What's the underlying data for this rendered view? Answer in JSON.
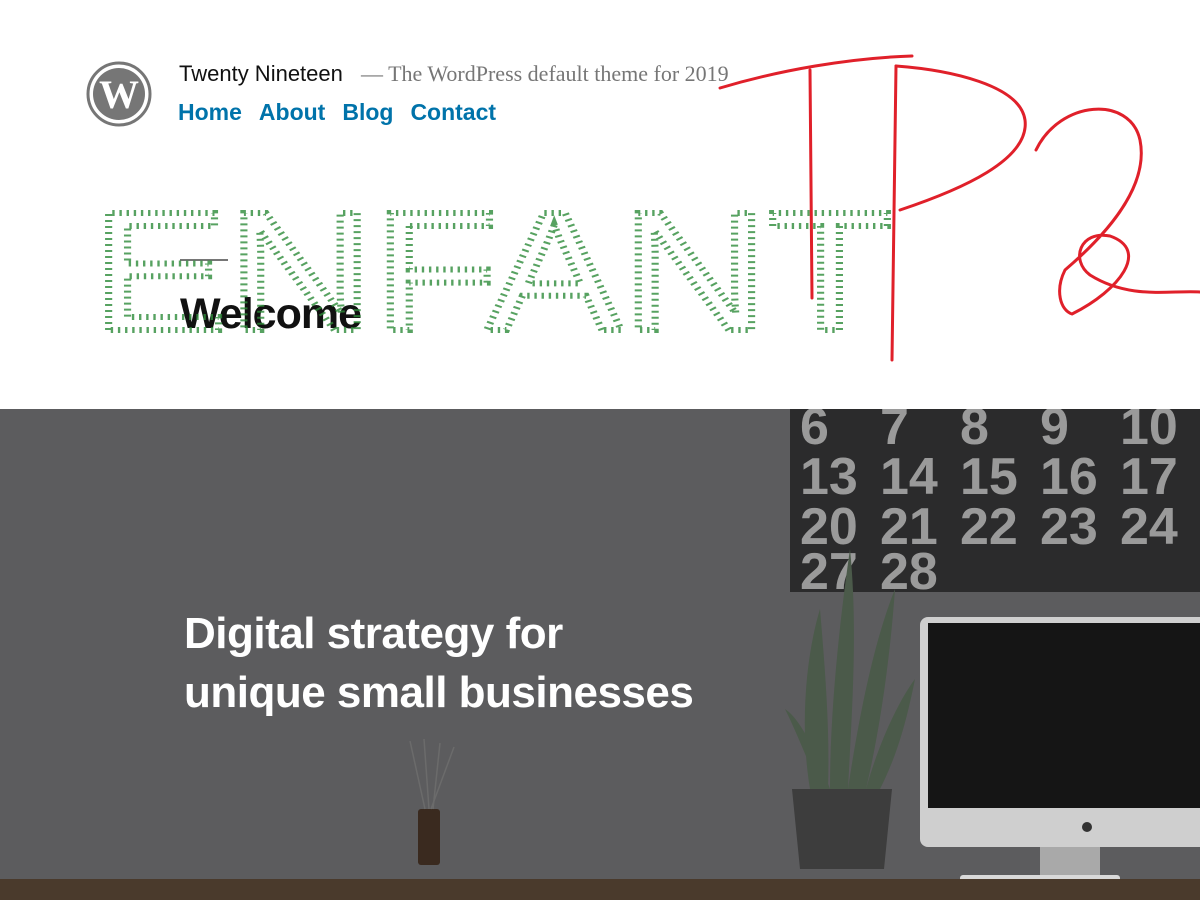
{
  "site": {
    "title": "Twenty Nineteen",
    "description": "— The WordPress default theme for 2019",
    "logo_icon": "wordpress-logo-icon"
  },
  "nav": {
    "items": [
      {
        "label": "Home"
      },
      {
        "label": "About"
      },
      {
        "label": "Blog"
      },
      {
        "label": "Contact"
      }
    ]
  },
  "page": {
    "title": "Welcome"
  },
  "hero": {
    "line1": "Digital strategy for",
    "line2": "unique small businesses",
    "calendar_numbers": [
      "6",
      "7",
      "8",
      "9",
      "10",
      "13",
      "14",
      "15",
      "16",
      "17",
      "20",
      "21",
      "22",
      "23",
      "24",
      "27",
      "28"
    ]
  },
  "annotations": {
    "green_text": "ENFANT",
    "red_text": "TP2",
    "green_color": "#2e8b3a",
    "red_color": "#e0202a"
  },
  "colors": {
    "link": "#0073aa",
    "hero_overlay": "#5c5c5e"
  }
}
